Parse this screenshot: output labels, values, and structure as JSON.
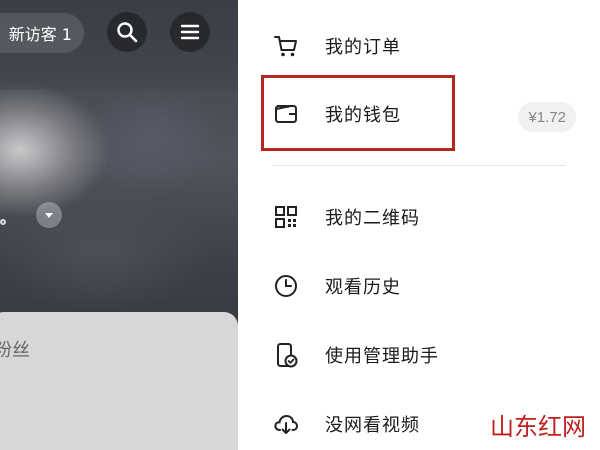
{
  "header": {
    "visitor_name": "新访客 1",
    "search_icon": "search-icon",
    "menu_icon": "hamburger-menu-icon"
  },
  "background": {
    "fans_label": "粉丝"
  },
  "drawer": {
    "items": [
      {
        "label": "我的订单",
        "icon": "cart-icon"
      },
      {
        "label": "我的钱包",
        "icon": "wallet-icon",
        "badge": "¥1.72"
      },
      {
        "label": "我的二维码",
        "icon": "qr-code-icon"
      },
      {
        "label": "观看历史",
        "icon": "clock-icon"
      },
      {
        "label": "使用管理助手",
        "icon": "phone-check-icon"
      },
      {
        "label": "没网看视频",
        "icon": "cloud-download-icon"
      }
    ],
    "highlight_color": "#b5261e"
  },
  "watermark": {
    "text": "山东红网"
  }
}
